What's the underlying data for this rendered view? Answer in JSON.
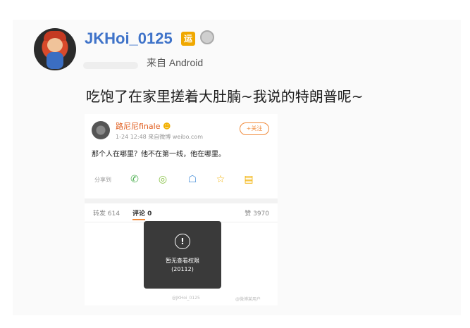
{
  "post": {
    "username": "JKHoi_0125",
    "badge_text": "运",
    "source": "来自 Android",
    "text": "吃饱了在家里搓着大肚腩~我说的特朗普呢~"
  },
  "embedded": {
    "name": "路尼尼finale",
    "emoji": "☻",
    "meta": "1-24 12:48 来自微博 weibo.com",
    "follow_label": "+关注",
    "content": "那个人在哪里？他不在第一线，他在哪里。",
    "share_label": "分享到",
    "tabs": {
      "repost": "转发 614",
      "comment": "评论 0",
      "like": "赞 3970"
    },
    "toast": {
      "line1": "暂无查看权限",
      "line2": "(20112)",
      "icon": "!"
    },
    "watermarks": [
      "@JKHoi_0125",
      "@微博某用户"
    ]
  }
}
